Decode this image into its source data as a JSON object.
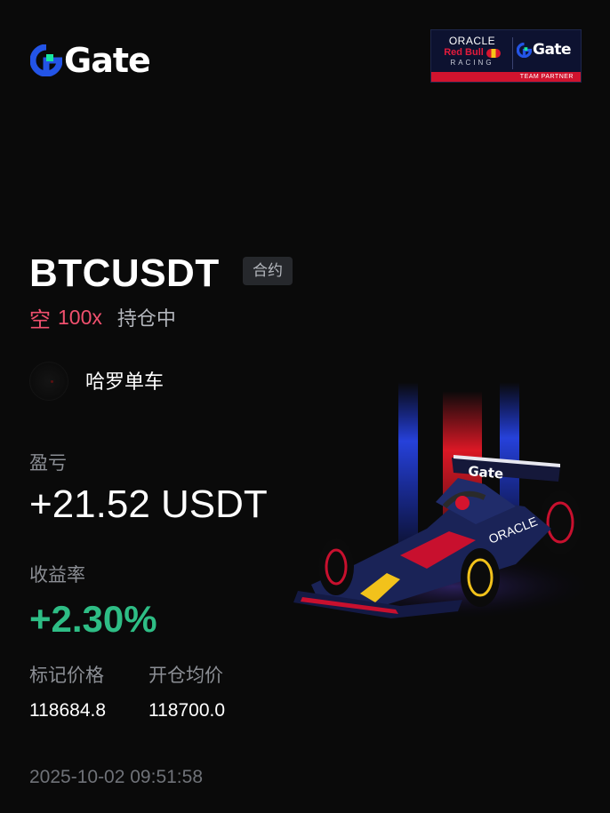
{
  "brand": {
    "logo_text": "Gate",
    "accent_blue": "#2354e6",
    "accent_green": "#17e6a1"
  },
  "partner": {
    "oracle": "ORACLE",
    "red_bull": "Red Bull",
    "racing": "RACING",
    "gate": "Gate",
    "team_partner": "TEAM PARTNER"
  },
  "position": {
    "symbol": "BTCUSDT",
    "market_type": "合约",
    "side": "空",
    "leverage": "100x",
    "status": "持仓中"
  },
  "user": {
    "name": "哈罗单车"
  },
  "pnl": {
    "label": "盈亏",
    "value": "+21.52 USDT"
  },
  "roi": {
    "label": "收益率",
    "value": "+2.30%"
  },
  "prices": {
    "mark_label": "标记价格",
    "mark_value": "118684.8",
    "entry_label": "开仓均价",
    "entry_value": "118700.0"
  },
  "timestamp": "2025-10-02 09:51:58",
  "colors": {
    "short_red": "#f0506e",
    "profit_green": "#2ebd85",
    "background": "#0a0a0a"
  }
}
